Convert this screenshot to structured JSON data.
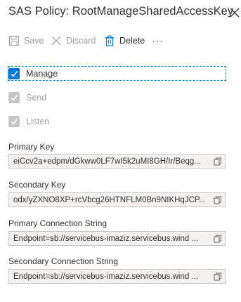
{
  "header": {
    "title": "SAS Policy: RootManageSharedAccessKey",
    "close_icon": "close-icon"
  },
  "toolbar": {
    "save_label": "Save",
    "discard_label": "Discard",
    "delete_label": "Delete",
    "more_label": "···"
  },
  "claims": [
    {
      "label": "Manage",
      "checked": true,
      "enabled": true
    },
    {
      "label": "Send",
      "checked": true,
      "enabled": false
    },
    {
      "label": "Listen",
      "checked": true,
      "enabled": false
    }
  ],
  "fields": [
    {
      "label": "Primary Key",
      "value": "eiCcv2a+edpm/dGkww0LF7wI5k2uMI8GH/Ir/Beqg..."
    },
    {
      "label": "Secondary Key",
      "value": "odx/yZXNO8XP+rcVbcg26HTNFLM0Bn9NIKHqJCP..."
    },
    {
      "label": "Primary Connection String",
      "value": "Endpoint=sb://servicebus-imaziz.servicebus.wind ..."
    },
    {
      "label": "Secondary Connection String",
      "value": "Endpoint=sb://servicebus-imaziz.servicebus.wind ..."
    }
  ],
  "colors": {
    "accent": "#0078d4",
    "disabled_check": "#c8c6c4",
    "field_bg": "#f3f2f1"
  }
}
